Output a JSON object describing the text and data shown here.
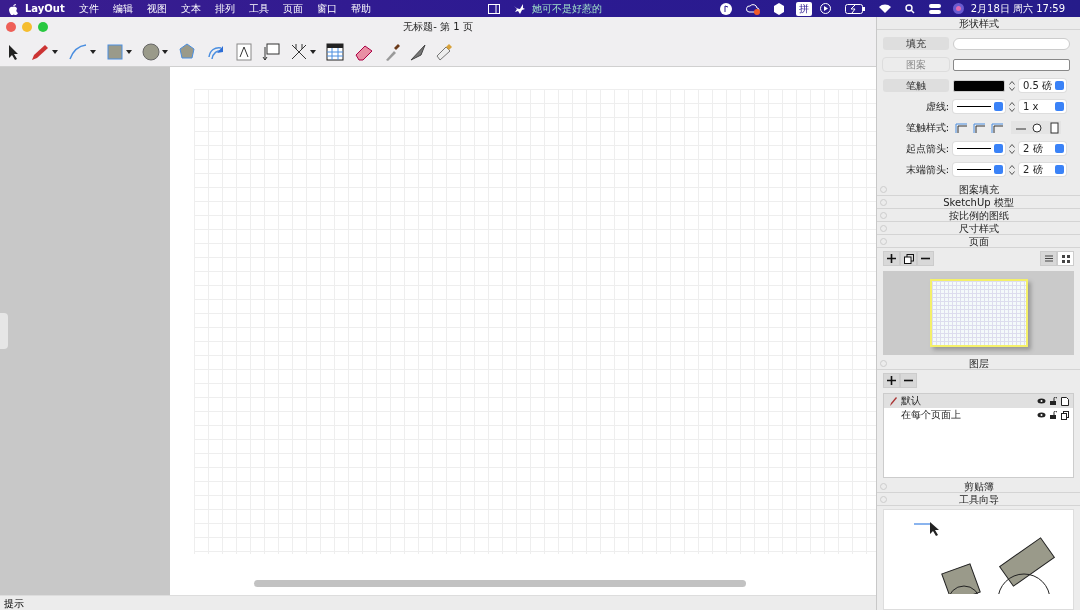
{
  "menubar": {
    "app": "LayOut",
    "menus": [
      "文件",
      "编辑",
      "视图",
      "文本",
      "排列",
      "工具",
      "页面",
      "窗口",
      "帮助"
    ],
    "now_playing": "她可不是好惹的",
    "input_method": "拼",
    "clock": "2月18日 周六 17:59"
  },
  "window": {
    "title": "无标题- 第 1 页"
  },
  "toolbar": [
    {
      "kind": "select",
      "dropdown": false
    },
    {
      "kind": "pencil",
      "dropdown": true
    },
    {
      "kind": "arc",
      "dropdown": true
    },
    {
      "kind": "rectangle",
      "dropdown": true
    },
    {
      "kind": "circle",
      "dropdown": true
    },
    {
      "kind": "polygon",
      "dropdown": false
    },
    {
      "kind": "offset",
      "dropdown": false
    },
    {
      "kind": "text",
      "dropdown": false
    },
    {
      "kind": "label",
      "dropdown": false
    },
    {
      "kind": "dimension",
      "dropdown": true
    },
    {
      "kind": "table",
      "dropdown": false
    },
    {
      "kind": "eraser",
      "dropdown": false
    },
    {
      "kind": "eyedropper",
      "dropdown": false
    },
    {
      "kind": "knife",
      "dropdown": false
    },
    {
      "kind": "paint",
      "dropdown": false
    }
  ],
  "shape_style": {
    "title": "形状样式",
    "swatches": [
      {
        "label": "填充",
        "enabled": true,
        "kind": "fill"
      },
      {
        "label": "图案",
        "enabled": false,
        "kind": "pattern"
      },
      {
        "label": "笔触",
        "enabled": true,
        "kind": "stroke",
        "width": "0.5 磅"
      }
    ],
    "dash": {
      "label": "虚线:",
      "scale": "1 x"
    },
    "stroke_style": {
      "label": "笔触样式:"
    },
    "arrows": [
      {
        "label": "起点箭头:",
        "size": "2 磅"
      },
      {
        "label": "末端箭头:",
        "size": "2 磅"
      }
    ]
  },
  "collapsed_panels": [
    "图案填充",
    "SketchUp 模型",
    "按比例的图纸",
    "尺寸样式"
  ],
  "pages": {
    "title": "页面",
    "views": [
      {
        "kind": "list",
        "selected": false
      },
      {
        "kind": "grid",
        "selected": true
      }
    ]
  },
  "layers": {
    "title": "图层",
    "rows": [
      {
        "name": "默认",
        "selected": true,
        "shared": false
      },
      {
        "name": "在每个页面上",
        "selected": false,
        "shared": true
      }
    ]
  },
  "clipboard": {
    "title": "剪贴簿"
  },
  "instructor": {
    "title": "工具向导"
  },
  "status_bar": {
    "text": "提示"
  }
}
